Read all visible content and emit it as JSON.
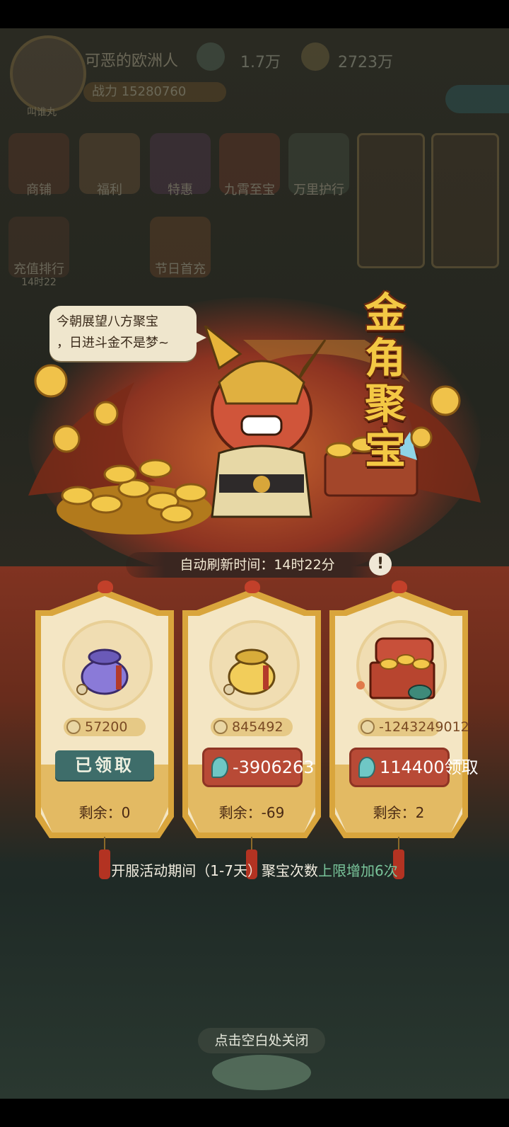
{
  "hud": {
    "avatar_name": "叫谁丸",
    "player_name": "可恶的欧洲人",
    "power": "战力 15280760",
    "resource1": "1.7万",
    "resource2": "2723万",
    "menu": [
      "商铺",
      "福利",
      "特惠",
      "九霄至宝",
      "万里护行",
      "充值排行",
      "节日首充"
    ],
    "rank_sub": "14时22"
  },
  "event": {
    "title_chars": [
      "金",
      "角",
      "聚",
      "宝"
    ],
    "speech_line1": "今朝展望八方聚宝",
    "speech_line2": "，日进斗金不是梦~",
    "refresh_text": "自动刷新时间：14时22分",
    "info_icon": "!"
  },
  "cards": [
    {
      "coin_value": "57200",
      "status_label": "已领取",
      "remaining": "剩余：0",
      "item": "purple-coin-bag"
    },
    {
      "coin_value": "845492",
      "price": "-3906263",
      "remaining": "剩余：-69",
      "item": "gold-coin-bag"
    },
    {
      "coin_value": "-1243249012",
      "price": "114400领取",
      "remaining": "剩余：2",
      "item": "treasure-chest"
    }
  ],
  "footer": {
    "limit_main": "开服活动期间（1-7天）聚宝次数",
    "limit_highlight": "上限增加6次",
    "close_hint": "点击空白处关闭"
  },
  "colors": {
    "gold": "#f3c844",
    "card_bg": "#f4e6c4",
    "button_red": "#b84a36",
    "claimed_green": "#3e6d6a",
    "highlight_green": "#79c49a"
  }
}
